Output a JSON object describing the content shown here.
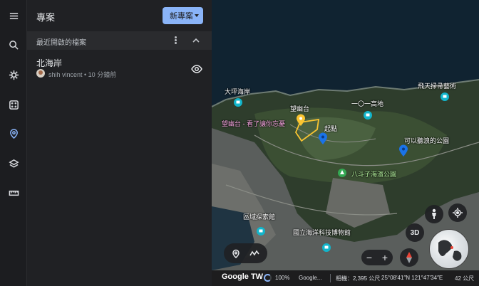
{
  "rail": {
    "items": [
      {
        "name": "menu-icon"
      },
      {
        "name": "search-icon"
      },
      {
        "name": "voyager-icon"
      },
      {
        "name": "feeling-lucky-icon"
      },
      {
        "name": "projects-icon",
        "active": true
      },
      {
        "name": "map-style-icon"
      },
      {
        "name": "measure-icon"
      }
    ]
  },
  "panel": {
    "title": "專案",
    "new_button": "新專案",
    "section_title": "最近開啟的檔案",
    "project": {
      "name": "北海岸",
      "meta": "shih vincent • 10 分鐘前"
    }
  },
  "map": {
    "labels": {
      "dakeng": "大坪海岸",
      "feitian": "飛天掃帚藝術",
      "wangyou": "望幽台",
      "yi_gaodi": "一〇一高地",
      "qidian": "起點",
      "wangyou_note": "望幽台 - 看了讓你忘憂",
      "kelang": "可以聽浪的公園",
      "badouzi": "八斗子海濱公園",
      "quyu": "區域探索館",
      "museum": "國立海洋科技博物館"
    },
    "zoom_minus": "−",
    "zoom_plus": "+",
    "btn_3d": "3D"
  },
  "status": {
    "logo": "Google TW",
    "percent": "100%",
    "source": "Google...",
    "distance": "相機：2,395 公尺",
    "coords": "25°08′41″N 121°47′34″E",
    "altitude": "42 公尺"
  },
  "colors": {
    "accent": "#8ab4f8",
    "panel_bg": "#202124",
    "polygon": "#f9c431"
  }
}
